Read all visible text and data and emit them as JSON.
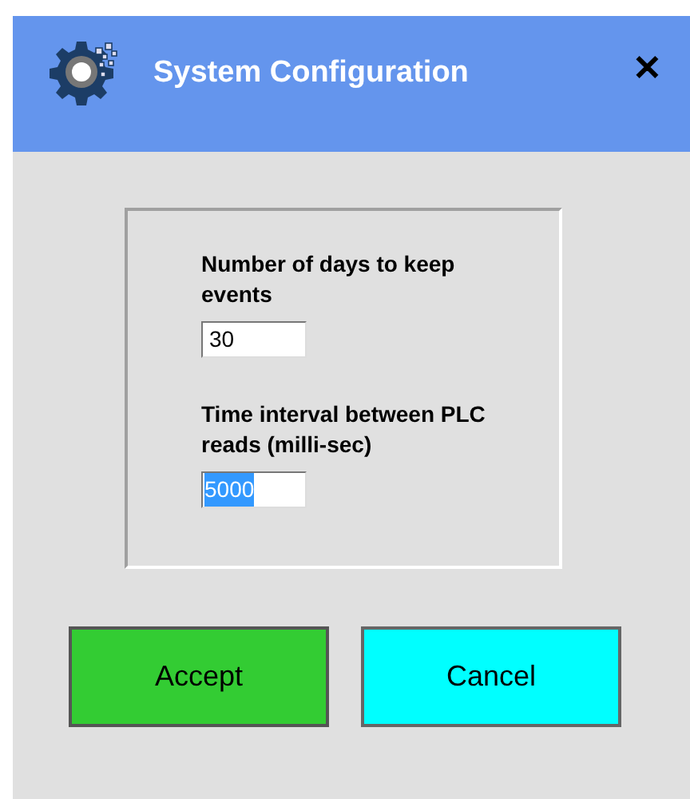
{
  "window": {
    "title": "System Configuration",
    "close": "✕"
  },
  "settings": [
    {
      "label": "Number of days to keep events",
      "value": "30",
      "selected": false
    },
    {
      "label": "Time interval between PLC reads (milli-sec)",
      "value": "5000",
      "selected": true
    }
  ],
  "buttons": [
    {
      "label": "Accept",
      "kind": "accept"
    },
    {
      "label": "Cancel",
      "kind": "cancel"
    }
  ]
}
